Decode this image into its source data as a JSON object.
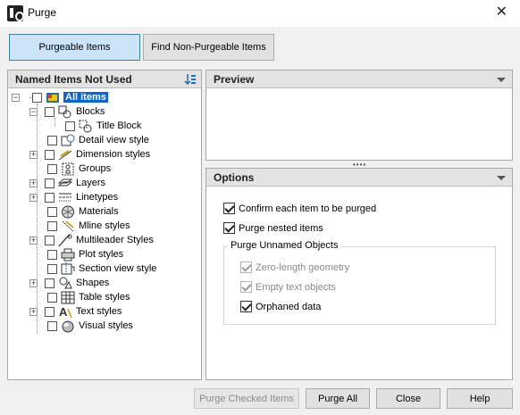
{
  "window": {
    "title": "Purge",
    "close_glyph": "✕"
  },
  "tabs": [
    {
      "label": "Purgeable Items",
      "active": true
    },
    {
      "label": "Find Non-Purgeable Items",
      "active": false
    }
  ],
  "left_panel": {
    "header": "Named Items Not Used",
    "tree": [
      {
        "label": "All items",
        "icon": "drawing-icon"
      },
      {
        "label": "Blocks",
        "icon": "block-icon"
      },
      {
        "label": "Title Block",
        "icon": "block-icon"
      },
      {
        "label": "Detail view style",
        "icon": "detail-view-icon"
      },
      {
        "label": "Dimension styles",
        "icon": "dimension-icon"
      },
      {
        "label": "Groups",
        "icon": "group-icon"
      },
      {
        "label": "Layers",
        "icon": "layers-icon"
      },
      {
        "label": "Linetypes",
        "icon": "linetype-icon"
      },
      {
        "label": "Materials",
        "icon": "material-icon"
      },
      {
        "label": "Mline styles",
        "icon": "mline-icon"
      },
      {
        "label": "Multileader Styles",
        "icon": "multileader-icon"
      },
      {
        "label": "Plot styles",
        "icon": "plot-icon"
      },
      {
        "label": "Section view style",
        "icon": "section-view-icon"
      },
      {
        "label": "Shapes",
        "icon": "shape-icon"
      },
      {
        "label": "Table styles",
        "icon": "table-icon"
      },
      {
        "label": "Text styles",
        "icon": "text-icon"
      },
      {
        "label": "Visual styles",
        "icon": "visual-style-icon"
      }
    ]
  },
  "preview_panel": {
    "header": "Preview"
  },
  "options_panel": {
    "header": "Options",
    "confirm_label": "Confirm each item to be purged",
    "confirm_checked": true,
    "nested_label": "Purge nested items",
    "nested_checked": true,
    "group_title": "Purge Unnamed Objects",
    "zero_length_label": "Zero-length geometry",
    "zero_length_checked": true,
    "empty_text_label": "Empty text objects",
    "empty_text_checked": true,
    "orphaned_label": "Orphaned data",
    "orphaned_checked": true
  },
  "footer": {
    "purge_checked": "Purge Checked Items",
    "purge_all": "Purge All",
    "close": "Close",
    "help": "Help"
  },
  "colors": {
    "accent": "#0a64d8",
    "active_tab": "#cce4f7"
  }
}
